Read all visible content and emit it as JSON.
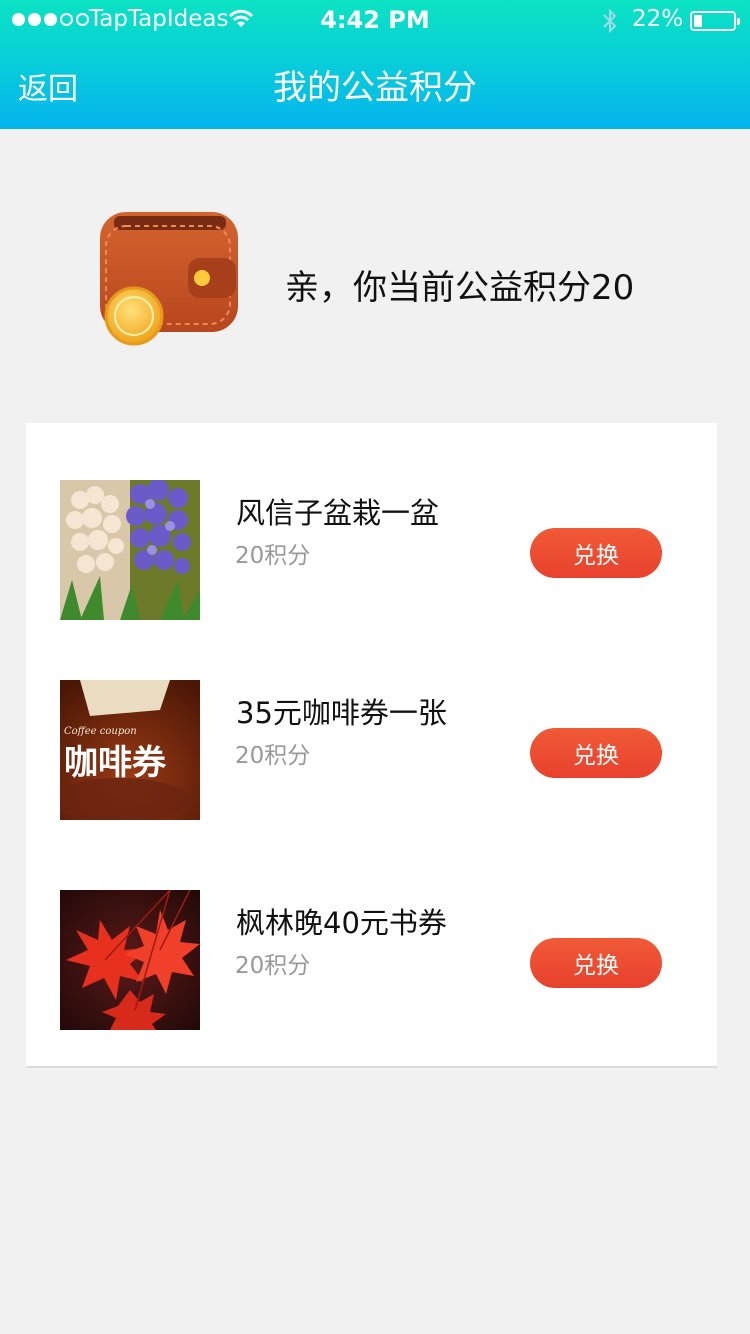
{
  "status_bar": {
    "carrier": "TapTapIdeas",
    "time": "4:42 PM",
    "battery": "22%",
    "battery_level": 0.22
  },
  "nav": {
    "back_label": "返回",
    "title": "我的公益积分"
  },
  "summary": {
    "text": "亲，你当前公益积分20"
  },
  "items": [
    {
      "title": "风信子盆栽一盆",
      "points": "20积分",
      "button": "兑换",
      "image": "hyacinth-photo"
    },
    {
      "title": "35元咖啡券一张",
      "points": "20积分",
      "button": "兑换",
      "image": "coffee-coupon-photo",
      "image_text_small": "Coffee coupon",
      "image_text_large": "咖啡券"
    },
    {
      "title": "枫林晚40元书券",
      "points": "20积分",
      "button": "兑换",
      "image": "maple-leaves-photo"
    }
  ],
  "colors": {
    "header_top": "#0be3c2",
    "header_bottom": "#04b4ee",
    "button": "#e8412d",
    "background": "#f1f1f1"
  }
}
